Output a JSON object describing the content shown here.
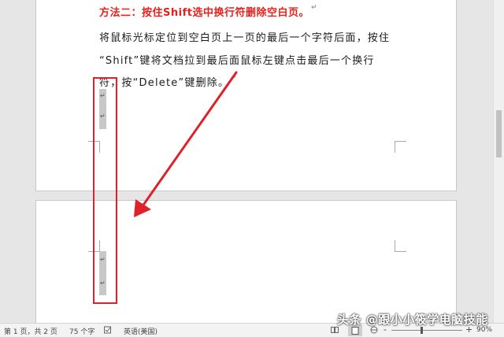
{
  "document": {
    "heading": "方法二：按住Shift选中换行符删除空白页。",
    "body_lines": [
      "将鼠标光标定位到空白页上一页的最后一个字符后面，按住",
      "“Shift”键将文档拉到最后面鼠标左键点击最后一个换行",
      "符，按“Delete”键删除。"
    ],
    "paragraph_mark": "↵"
  },
  "statusbar": {
    "page_info": "第 1 页，共 2 页",
    "word_count": "75 个字",
    "language": "英语(美国)",
    "zoom_out": "-",
    "zoom_in": "+",
    "zoom_level": "90%",
    "zoom_fraction": 0.42
  },
  "watermark": {
    "text": "头条 @跟小小筱学电脑技能"
  },
  "colors": {
    "heading": "#e8201c",
    "annotation": "#e0202a",
    "selection": "#c8c8c8"
  }
}
